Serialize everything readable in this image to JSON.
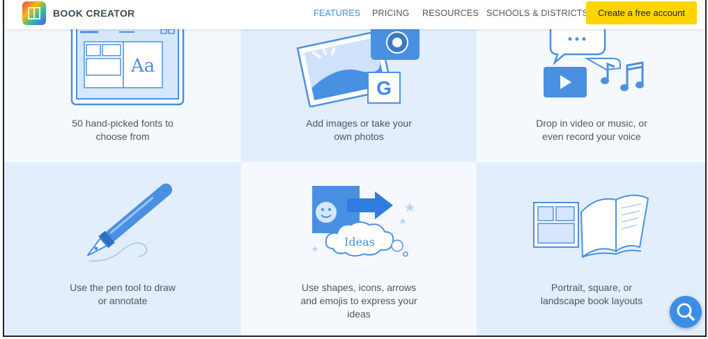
{
  "header": {
    "brand": "BOOK CREATOR",
    "nav": {
      "features": "FEATURES",
      "pricing": "PRICING",
      "resources": "RESOURCES",
      "schools": "SCHOOLS & DISTRICTS"
    },
    "cta": "Create a free account"
  },
  "features": {
    "fonts": {
      "line1": "50 hand-picked fonts to",
      "line2": "choose from",
      "sample": "Aa"
    },
    "images": {
      "line1": "Add images or take your",
      "line2": "own photos",
      "google": "G"
    },
    "media": {
      "line1": "Drop in video or music, or",
      "line2": "even record your voice"
    },
    "pen": {
      "line1": "Use the pen tool to draw",
      "line2": "or annotate"
    },
    "shapes": {
      "line1": "Use shapes, icons, arrows",
      "line2": "and emojis to express your",
      "line3": "ideas",
      "cloud": "Ideas"
    },
    "layouts": {
      "line1": "Portrait, square, or",
      "line2": "landscape book layouts"
    }
  },
  "colors": {
    "accent": "#3a8ee6",
    "cta": "#ffd500",
    "cell_light": "#f5f9fe",
    "cell_dark": "#e3eefc"
  }
}
